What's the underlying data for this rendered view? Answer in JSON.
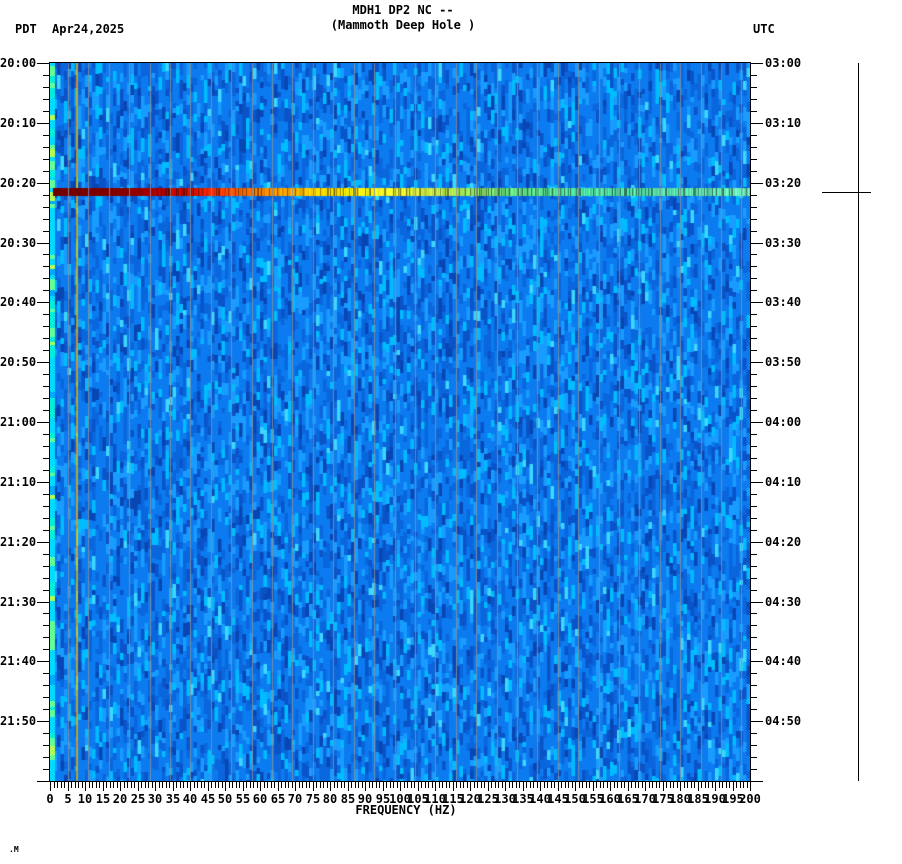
{
  "header": {
    "timezone_left": "PDT",
    "date": "Apr24,2025",
    "title": "MDH1 DP2 NC --",
    "subtitle": "(Mammoth Deep Hole )",
    "timezone_right": "UTC"
  },
  "footer": {
    "mark": ".M"
  },
  "chart_data": {
    "type": "heatmap",
    "title": "MDH1 DP2 NC --",
    "subtitle": "(Mammoth Deep Hole )",
    "station": "MDH1 DP2 NC",
    "station_name": "Mammoth Deep Hole",
    "date": "Apr24,2025",
    "description": "Two-hour seismic spectrogram. Low-amplitude blue background noise, elevated low-frequency energy below ~1.5 Hz, persistent narrowband tone near 7.5 Hz, and one broadband event band (dark red at low frequency grading to green at high frequency) at 20:21 PDT / 03:21 UTC. A time-cursor crosshair sits in the right margin aligned with the event.",
    "x_axis": {
      "label": "FREQUENCY (HZ)",
      "min": 0,
      "max": 200,
      "major_step": 5,
      "minor_step": 1
    },
    "left_axis": {
      "timezone": "PDT",
      "start": "20:00",
      "end": "22:00",
      "minor_step_minutes": 2,
      "major_labels": [
        "20:00",
        "20:10",
        "20:20",
        "20:30",
        "20:40",
        "20:50",
        "21:00",
        "21:10",
        "21:20",
        "21:30",
        "21:40",
        "21:50"
      ]
    },
    "right_axis": {
      "timezone": "UTC",
      "start": "03:00",
      "end": "05:00",
      "minor_step_minutes": 2,
      "major_labels": [
        "03:00",
        "03:10",
        "03:20",
        "03:30",
        "03:40",
        "03:50",
        "04:00",
        "04:10",
        "04:20",
        "04:30",
        "04:40",
        "04:50"
      ]
    },
    "grid": {
      "vertical_lines": true,
      "color": "#82909b",
      "first_offset_hz": 5.15,
      "spacing_hz": 5.83
    },
    "background_palette": [
      {
        "color": "#0d7bf0",
        "weight": 40
      },
      {
        "color": "#0a66dc",
        "weight": 18
      },
      {
        "color": "#0a53c8",
        "weight": 10
      },
      {
        "color": "#0846b4",
        "weight": 6
      },
      {
        "color": "#189cff",
        "weight": 14
      },
      {
        "color": "#00bdff",
        "weight": 8
      },
      {
        "color": "#3cd8ff",
        "weight": 2
      }
    ],
    "low_freq_edge": {
      "max_hz": 1.0,
      "palette": [
        {
          "color": "#00dcff",
          "weight": 50
        },
        {
          "color": "#00f0dc",
          "weight": 20
        },
        {
          "color": "#64ff96",
          "weight": 15
        },
        {
          "color": "#b4ff50",
          "weight": 8
        },
        {
          "color": "#00aaff",
          "weight": 7
        }
      ]
    },
    "persistent_tone": {
      "hz": 7.5,
      "palette": [
        {
          "color": "#dcb400",
          "weight": 60
        },
        {
          "color": "#ff9600",
          "weight": 20
        },
        {
          "color": "#e6dc00",
          "weight": 20
        }
      ]
    },
    "event": {
      "time_pdt": "20:21",
      "time_utc": "03:21",
      "start_minutes_after_start": 20.9,
      "duration_minutes": 1.4,
      "freq_range_hz": [
        0,
        200
      ],
      "color_stops": [
        {
          "hz": 0,
          "color": "#6e0000"
        },
        {
          "hz": 22,
          "color": "#8b0000"
        },
        {
          "hz": 30,
          "color": "#aa0000"
        },
        {
          "hz": 38,
          "color": "#d70a00"
        },
        {
          "hz": 46,
          "color": "#ff2800"
        },
        {
          "hz": 54,
          "color": "#ff6000"
        },
        {
          "hz": 64,
          "color": "#ff9600"
        },
        {
          "hz": 74,
          "color": "#ffc800"
        },
        {
          "hz": 85,
          "color": "#ffeb00"
        },
        {
          "hz": 95,
          "color": "#fafa28"
        },
        {
          "hz": 105,
          "color": "#dcf03c"
        },
        {
          "hz": 118,
          "color": "#a0e65a"
        },
        {
          "hz": 132,
          "color": "#64e182"
        },
        {
          "hz": 150,
          "color": "#50e1a0"
        },
        {
          "hz": 175,
          "color": "#5ae6af"
        },
        {
          "hz": 200,
          "color": "#6eebb9"
        }
      ]
    },
    "time_cursor": {
      "aligned_time_pdt": "20:21",
      "aligned_time_utc": "03:21"
    }
  }
}
